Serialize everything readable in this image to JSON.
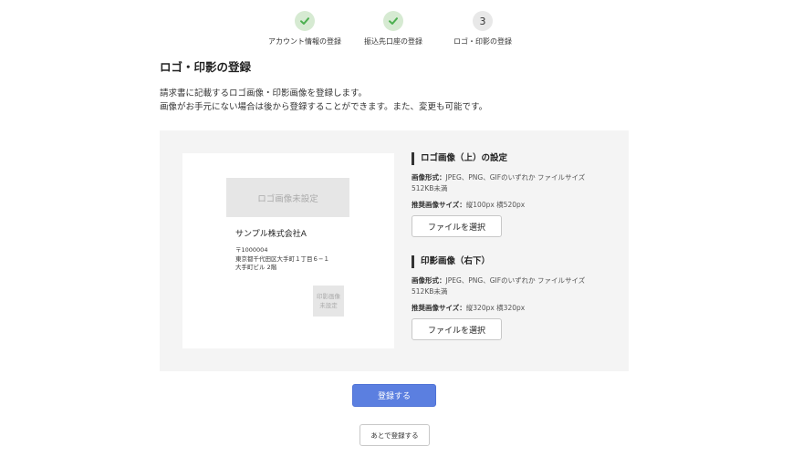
{
  "stepper": {
    "steps": [
      {
        "label": "アカウント情報の登録",
        "state": "done",
        "icon": "check-icon"
      },
      {
        "label": "振込先口座の登録",
        "state": "done",
        "icon": "check-icon"
      },
      {
        "label": "ロゴ・印影の登録",
        "state": "current",
        "number": "3"
      }
    ],
    "done_color": "#d6ead2",
    "check_color": "#4caf50"
  },
  "page": {
    "title": "ロゴ・印影の登録",
    "intro_line1": "請求書に記載するロゴ画像・印影画像を登録します。",
    "intro_line2": "画像がお手元にない場合は後から登録することができます。また、変更も可能です。"
  },
  "preview": {
    "logo_placeholder": "ロゴ画像未設定",
    "company_name": "サンプル株式会社A",
    "postal": "〒1000004",
    "address_line1": "東京都千代田区大手町１丁目６−１",
    "address_line2": "大手町ビル 2階",
    "stamp_placeholder_line1": "印影画像",
    "stamp_placeholder_line2": "未設定"
  },
  "logo_setting": {
    "title": "ロゴ画像（上）の設定",
    "format_label": "画像形式：",
    "format_value": "JPEG、PNG、GIFのいずれか ファイルサイズ512KB未満",
    "size_label": "推奨画像サイズ：",
    "size_value": "縦100px 横520px",
    "button_label": "ファイルを選択"
  },
  "stamp_setting": {
    "title": "印影画像（右下）",
    "format_label": "画像形式：",
    "format_value": "JPEG、PNG、GIFのいずれか ファイルサイズ512KB未満",
    "size_label": "推奨画像サイズ：",
    "size_value": "縦320px 横320px",
    "button_label": "ファイルを選択"
  },
  "actions": {
    "submit_label": "登録する",
    "later_label": "あとで登録する",
    "accent_color": "#5b7fe0"
  }
}
